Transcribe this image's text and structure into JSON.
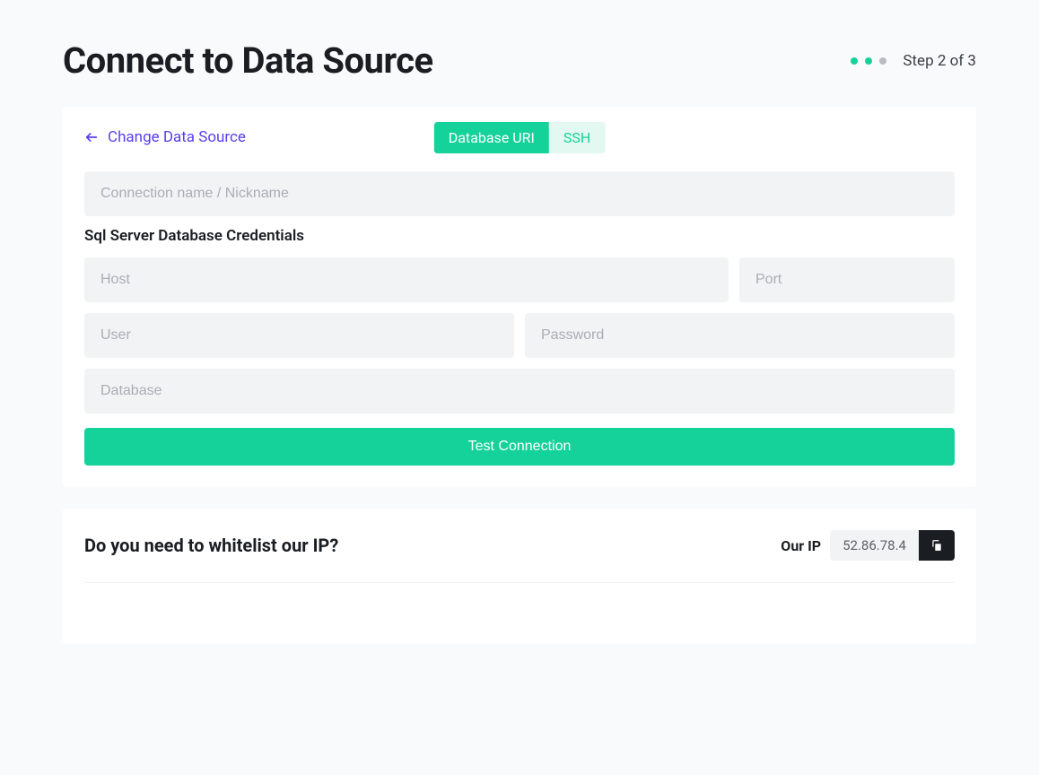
{
  "header": {
    "title": "Connect to Data Source",
    "step_label": "Step 2 of 3"
  },
  "card": {
    "back_label": "Change Data Source",
    "tabs": {
      "uri": "Database URI",
      "ssh": "SSH"
    },
    "section_label": "Sql Server Database Credentials",
    "placeholders": {
      "nickname": "Connection name / Nickname",
      "host": "Host",
      "port": "Port",
      "user": "User",
      "password": "Password",
      "database": "Database"
    },
    "test_button": "Test Connection"
  },
  "ip": {
    "question": "Do you need to whitelist our IP?",
    "label": "Our IP",
    "value": "52.86.78.4"
  }
}
